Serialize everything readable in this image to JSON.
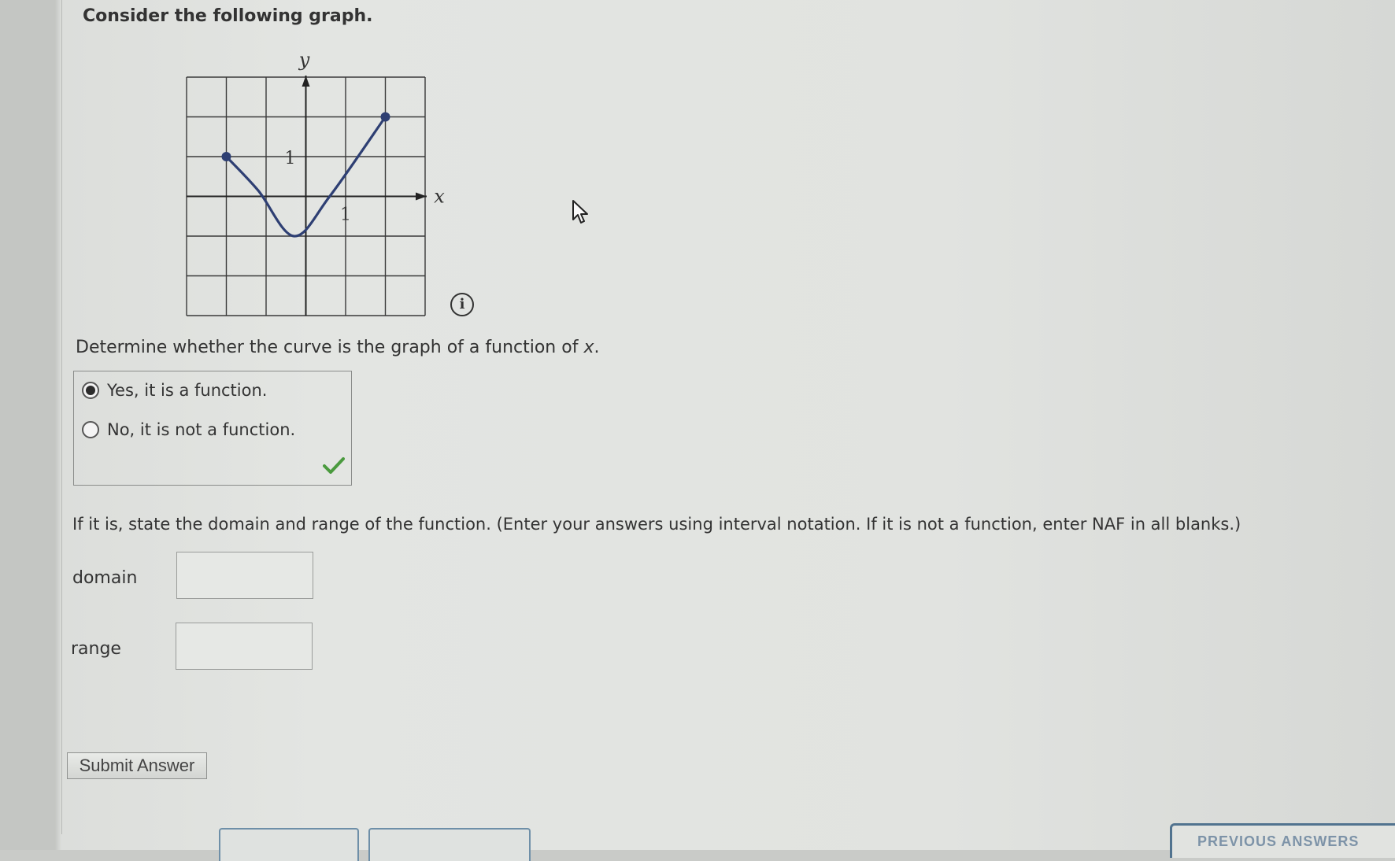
{
  "prompt": "Consider the following graph.",
  "graph": {
    "y_axis_label": "y",
    "x_axis_label": "x",
    "tick_label_y": "1",
    "tick_label_x": "1",
    "curve_color": "#2e3f73",
    "grid_color": "#3a3a3a",
    "x_range": [
      -3,
      3
    ],
    "y_range": [
      -3,
      3
    ],
    "curve_points": [
      [
        -2,
        1
      ],
      [
        -1.2,
        0.15
      ],
      [
        -0.3,
        -1
      ],
      [
        0.6,
        0
      ],
      [
        2,
        2
      ]
    ],
    "endpoints": [
      [
        -2,
        1
      ],
      [
        2,
        2
      ]
    ]
  },
  "info_icon": "info-icon",
  "question": {
    "text_before": "Determine whether the curve is the graph of a function of ",
    "var": "x",
    "text_after": "."
  },
  "choices": [
    {
      "label": "Yes, it is a function.",
      "selected": true
    },
    {
      "label": "No, it is not a function.",
      "selected": false
    }
  ],
  "feedback_icon": "checkmark-icon",
  "feedback_color": "#4a9a3e",
  "instructions": "If it is, state the domain and range of the function. (Enter your answers using interval notation. If it is not a function, enter NAF in all blanks.)",
  "fields": {
    "domain_label": "domain",
    "domain_value": "",
    "range_label": "range",
    "range_value": ""
  },
  "submit_label": "Submit Answer",
  "previous_answers_label": "PREVIOUS ANSWERS"
}
